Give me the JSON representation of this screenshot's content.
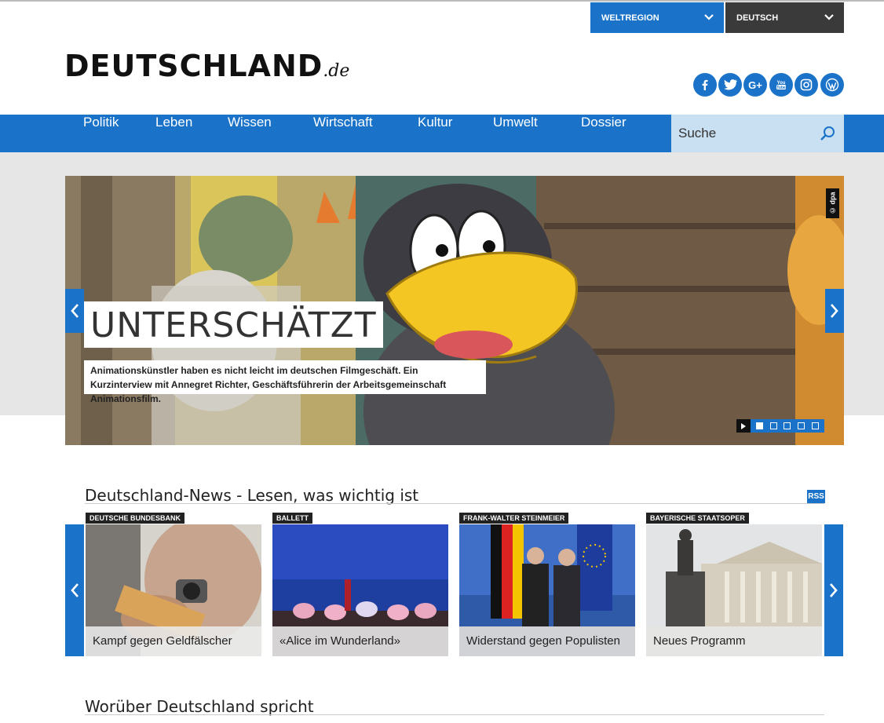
{
  "header": {
    "region_select": "WELTREGION",
    "language_select": "DEUTSCH",
    "logo_main": "DEUTSCHLAND",
    "logo_suffix": ".de",
    "social": [
      "facebook-icon",
      "twitter-icon",
      "google-plus-icon",
      "youtube-icon",
      "instagram-icon",
      "wordpress-icon"
    ]
  },
  "nav": {
    "items": [
      "Politik",
      "Leben",
      "Wissen",
      "Wirtschaft",
      "Kultur",
      "Umwelt",
      "Dossier"
    ],
    "search_placeholder": "Suche"
  },
  "hero": {
    "title": "UNTERSCHÄTZT",
    "subtitle": "Animationskünstler haben es nicht leicht im deutschen Filmgeschäft. Ein Kurzinterview mit Annegret Richter, Geschäftsführerin der Arbeitsgemeinschaft Animationsfilm.",
    "credit": "© dpa",
    "slide_count": 5,
    "active_slide": 1
  },
  "news": {
    "title": "Deutschland-News - Lesen, was wichtig ist",
    "rss": "RSS",
    "cards": [
      {
        "tag": "DEUTSCHE BUNDESBANK",
        "caption": "Kampf gegen Geldfälscher"
      },
      {
        "tag": "BALLETT",
        "caption": "«Alice im Wunderland»"
      },
      {
        "tag": "FRANK-WALTER STEINMEIER",
        "caption": "Widerstand gegen Populisten"
      },
      {
        "tag": "BAYERISCHE STAATSOPER",
        "caption": "Neues Programm"
      }
    ]
  },
  "section2": {
    "title": "Worüber Deutschland spricht"
  },
  "colors": {
    "brand_blue": "#1a73c9",
    "dark_select": "#3a3a3a",
    "search_bg": "#c9dff2"
  }
}
